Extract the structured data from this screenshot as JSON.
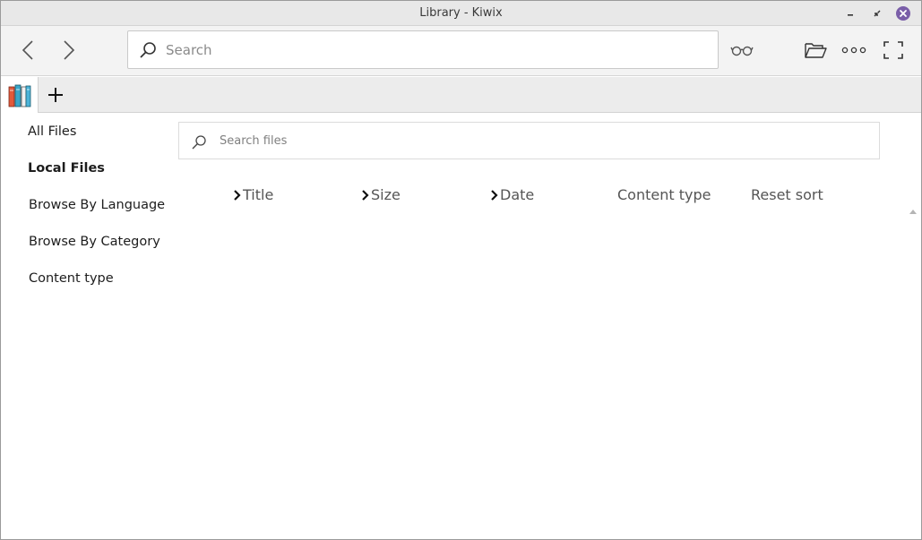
{
  "window": {
    "title": "Library - Kiwix"
  },
  "toolbar": {
    "search_placeholder": "Search"
  },
  "sidebar": {
    "items": [
      {
        "label": "All Files",
        "active": false
      },
      {
        "label": "Local Files",
        "active": true
      },
      {
        "label": "Browse By Language",
        "active": false
      },
      {
        "label": "Browse By Category",
        "active": false
      },
      {
        "label": "Content type",
        "active": false
      }
    ]
  },
  "content": {
    "search_placeholder": "Search files",
    "sort": {
      "title": "Title",
      "size": "Size",
      "date": "Date",
      "content_type": "Content type",
      "reset": "Reset sort"
    }
  },
  "icons": {
    "back": "chevron-left-icon",
    "forward": "chevron-right-icon",
    "search": "search-icon",
    "reading_list": "glasses-icon",
    "open_file": "folder-open-icon",
    "more": "more-dots-icon",
    "fullscreen": "fullscreen-icon",
    "library_tab": "library-books-icon",
    "new_tab": "plus-icon"
  },
  "colors": {
    "close_button": "#7a5ea8",
    "toolbar_bg": "#f3f3f3"
  }
}
